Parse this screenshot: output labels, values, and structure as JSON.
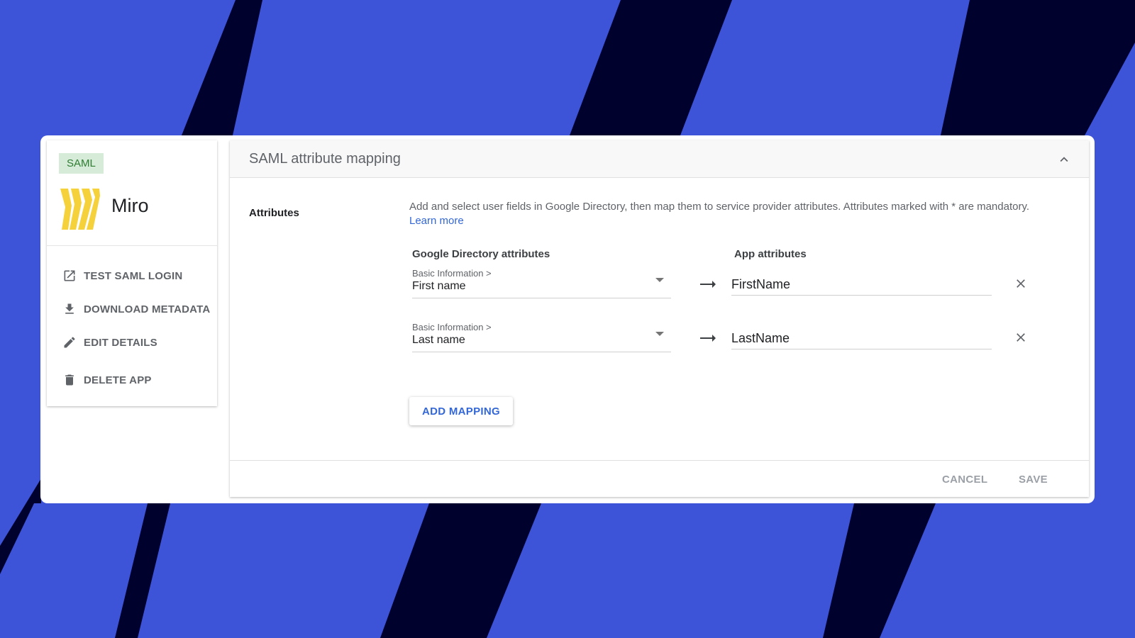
{
  "sidebar": {
    "tag": "SAML",
    "app_name": "Miro",
    "items": [
      {
        "label": "TEST SAML LOGIN",
        "icon": "open-in-new-icon"
      },
      {
        "label": "DOWNLOAD METADATA",
        "icon": "download-icon"
      },
      {
        "label": "EDIT DETAILS",
        "icon": "pencil-icon"
      },
      {
        "label": "DELETE APP",
        "icon": "trash-icon"
      }
    ]
  },
  "panel": {
    "title": "SAML attribute mapping",
    "section_label": "Attributes",
    "description": "Add and select user fields in Google Directory, then map them to service provider attributes. Attributes marked with * are mandatory.",
    "learn_more": "Learn more",
    "col_directory": "Google Directory attributes",
    "col_app": "App attributes",
    "mappings": [
      {
        "category": "Basic Information >",
        "field": "First name",
        "app_value": "FirstName"
      },
      {
        "category": "Basic Information >",
        "field": "Last name",
        "app_value": "LastName"
      }
    ],
    "add_mapping": "ADD MAPPING",
    "cancel": "CANCEL",
    "save": "SAVE"
  },
  "colors": {
    "background": "#3d54d9",
    "stripe": "#01012e",
    "logo": "#f5d13b",
    "accent": "#3367d6",
    "tag_bg": "#d6ecd8",
    "tag_text": "#2e7d32"
  }
}
